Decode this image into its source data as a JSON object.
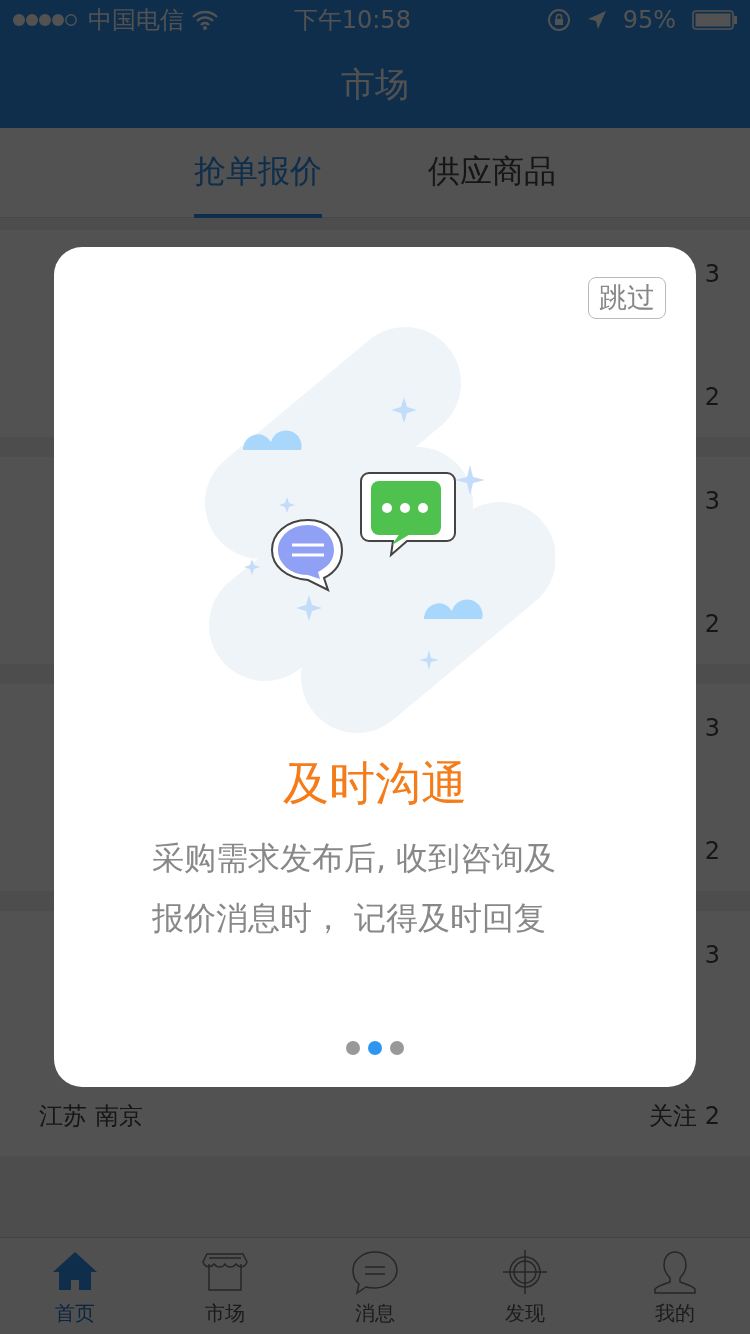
{
  "status_bar": {
    "carrier": "中国电信",
    "time": "下午10:58",
    "battery": "95%"
  },
  "nav": {
    "title": "市场"
  },
  "tabs": [
    {
      "label": "抢单报价",
      "selected": true
    },
    {
      "label": "供应商品",
      "selected": false
    }
  ],
  "cards": [
    {
      "date": "3",
      "follow": "2"
    },
    {
      "date": "3",
      "follow": "2"
    },
    {
      "date": "3",
      "follow": "2"
    },
    {
      "date": "3",
      "location": "江苏 南京",
      "follow": "关注 2"
    }
  ],
  "tab_bar": [
    {
      "label": "首页",
      "kind": "home",
      "selected": true
    },
    {
      "label": "市场",
      "kind": "shop",
      "selected": false
    },
    {
      "label": "消息",
      "kind": "chat",
      "selected": false
    },
    {
      "label": "发现",
      "kind": "target",
      "selected": false
    },
    {
      "label": "我的",
      "kind": "person",
      "selected": false
    }
  ],
  "guide": {
    "skip": "跳过",
    "title": "及时沟通",
    "description": [
      "采购需求发布后, 收到咨询及",
      "报价消息时， 记得及时回复"
    ],
    "pages": [
      {
        "selected": false
      },
      {
        "selected": true
      },
      {
        "selected": false
      }
    ]
  }
}
